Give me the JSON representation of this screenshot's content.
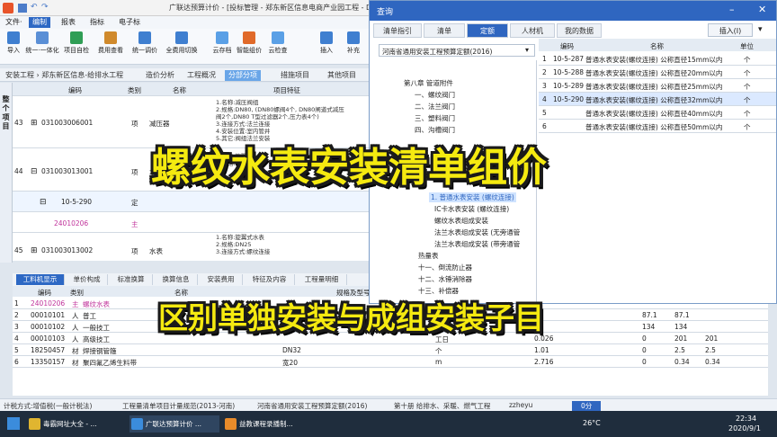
{
  "app": {
    "title": "广联达预算计价 - [投标管理 - 郑东新区信息电商产业园工程 - D:/"
  },
  "menu": [
    "文件·",
    "编制",
    "报表",
    "指标",
    "电子标"
  ],
  "toolbar": [
    "导入",
    "统一·一体化",
    "项目自检",
    "费用查看",
    "统一调价",
    "全费用切换",
    "云存档",
    "智能组价",
    "云检查",
    "插入",
    "补充"
  ],
  "tabs": {
    "breadcrumb": "安装工程 › 郑东新区信息-给排水工程",
    "items": [
      "造价分析",
      "工程概况",
      "分部分项",
      "措施项目",
      "其他项目"
    ]
  },
  "sidebar": "整个项目",
  "grid": {
    "headers": [
      "编码",
      "类别",
      "名称",
      "项目特征"
    ],
    "rows": [
      {
        "num": "43",
        "code": "031003006001",
        "type": "项",
        "name": "减压器",
        "feat": "1.名称:减压阀组\n2.规格:DN80, (DN80螺阀4个, DN80闸道式减压\n阀2个,DN80 T型过滤器2个,压力表4个)\n3.连接方式:法兰连接\n4.安装位置:室内管井\n5.其它:阀组法兰安装"
      },
      {
        "num": "44",
        "code": "031003013001",
        "type": "项",
        "name": "水表",
        "feat": "1.名称:旋翼式水表\n2.规格:DN32"
      },
      {
        "num": "",
        "code": "10-5-290",
        "type": "定",
        "name": "",
        "feat": ""
      },
      {
        "num": "",
        "code": "24010206",
        "type": "主",
        "name": "",
        "feat": ""
      },
      {
        "num": "45",
        "code": "031003013002",
        "type": "项",
        "name": "水表",
        "feat": "1.名称:旋翼式水表\n2.规格:DN25\n3.连接方式:螺纹连接"
      }
    ]
  },
  "bottomtabs": [
    "工料机显示",
    "单价构成",
    "标准换算",
    "换算信息",
    "安装费用",
    "特征及内容",
    "工程量明细"
  ],
  "bottom": {
    "headers": [
      "编码",
      "类别",
      "名称",
      "规格及型号"
    ],
    "rows": [
      {
        "num": "1",
        "code": "24010206",
        "type": "主",
        "name": "螺纹水表",
        "spec": "",
        "unit": "",
        "q1": "",
        "q2": "",
        "q3": "",
        "q4": ""
      },
      {
        "num": "2",
        "code": "00010101",
        "type": "人",
        "name": "普工",
        "spec": "",
        "unit": "",
        "q1": "",
        "q2": "87.1",
        "q3": "87.1",
        "q4": ""
      },
      {
        "num": "3",
        "code": "00010102",
        "type": "人",
        "name": "一般技工",
        "spec": "",
        "unit": "",
        "q1": "",
        "q2": "134",
        "q3": "134",
        "q4": ""
      },
      {
        "num": "4",
        "code": "00010103",
        "type": "人",
        "name": "高级技工",
        "spec": "",
        "unit": "工日",
        "q1": "0.026",
        "q2": "0",
        "q3": "201",
        "q4": "201"
      },
      {
        "num": "5",
        "code": "18250457",
        "type": "材",
        "name": "焊接钢管箍",
        "spec": "DN32",
        "unit": "个",
        "q1": "1.01",
        "q2": "0",
        "q3": "2.5",
        "q4": "2.5"
      },
      {
        "num": "6",
        "code": "13350157",
        "type": "材",
        "name": "聚四氟乙烯生料带",
        "spec": "宽20",
        "unit": "m",
        "q1": "2.716",
        "q2": "0",
        "q3": "0.34",
        "q4": "0.34"
      }
    ]
  },
  "status": [
    "计税方式:增值税(一般计税法)",
    "工程量清单项目计量规范(2013-河南)",
    "河南省通用安装工程预算定额(2016)",
    "第十册 给排水、采暖、燃气工程",
    "zzheyu",
    "0分"
  ],
  "taskbar": [
    "毒霸网址大全 - ...",
    "广联达预算计价 ...",
    "益教课程录播制..."
  ],
  "clock": {
    "time": "22:34",
    "date": "2020/9/1",
    "temp": "26°C"
  },
  "dialog": {
    "title": "查询",
    "tabs": [
      "清单指引",
      "清单",
      "定额",
      "人材机",
      "我的数据"
    ],
    "insert_button": "插入(I)",
    "dropdown": "河南省通用安装工程预算定额(2016)",
    "tree": [
      "第八章 管道附件",
      "一、螺纹阀门",
      "二、法兰阀门",
      "三、塑料阀门",
      "四、沟槽阀门",
      "1. 普通水表安装 (螺纹连接)",
      "IC卡水表安装 (螺纹连接)",
      "螺纹水表组成安装",
      "法兰水表组成安装 (无旁通管",
      "法兰水表组成安装 (带旁通管",
      "热量表",
      "十一、倒流防止器",
      "十二、水锤消除器",
      "十三、补偿器"
    ],
    "grid_headers": [
      "编码",
      "名称",
      "单位"
    ],
    "grid_rows": [
      {
        "num": "1",
        "code": "10-5-287",
        "name": "普通水表安装(螺纹连接) 公称直径15mm以内",
        "unit": "个"
      },
      {
        "num": "2",
        "code": "10-5-288",
        "name": "普通水表安装(螺纹连接) 公称直径20mm以内",
        "unit": "个"
      },
      {
        "num": "3",
        "code": "10-5-289",
        "name": "普通水表安装(螺纹连接) 公称直径25mm以内",
        "unit": "个"
      },
      {
        "num": "4",
        "code": "10-5-290",
        "name": "普通水表安装(螺纹连接) 公称直径32mm以内",
        "unit": "个"
      },
      {
        "num": "5",
        "code": "",
        "name": "普通水表安装(螺纹连接) 公称直径40mm以内",
        "unit": "个"
      },
      {
        "num": "6",
        "code": "",
        "name": "普通水表安装(螺纹连接) 公称直径50mm以内",
        "unit": "个"
      }
    ]
  },
  "overlay": {
    "headline": "螺纹水表安装清单组价",
    "subline": "区别单独安装与成组安装子目"
  },
  "colors": {
    "accent": "#2f66c0",
    "banner_text": "#f5ea10",
    "main_item_text": "#c0339b"
  }
}
